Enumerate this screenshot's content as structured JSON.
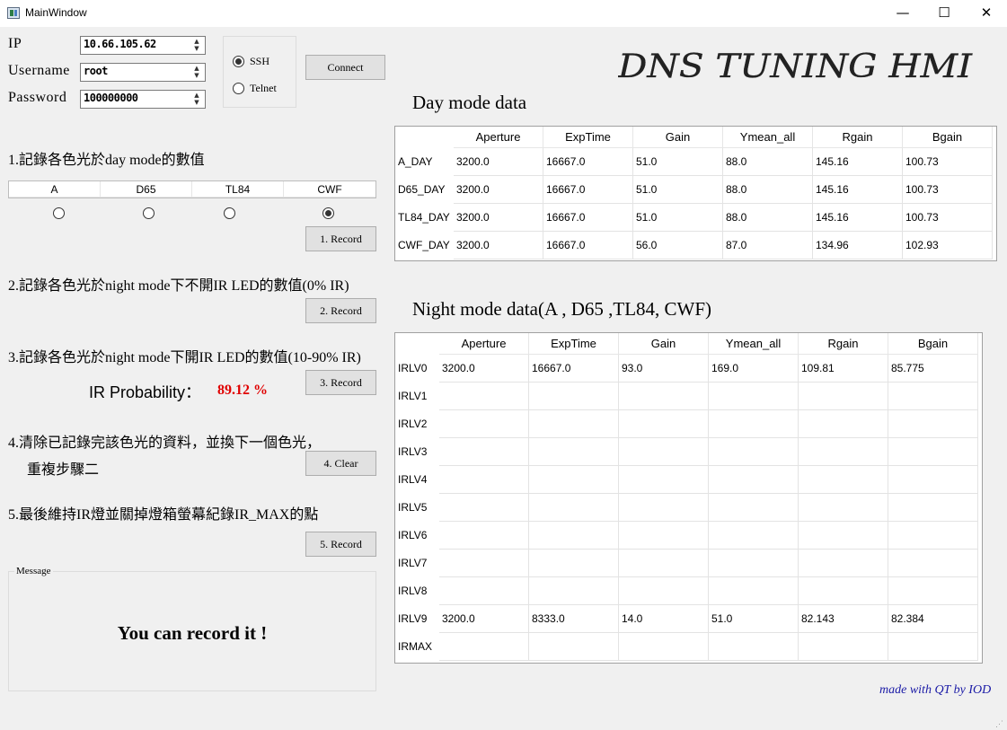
{
  "window": {
    "title": "MainWindow",
    "minimize": "—",
    "maximize": "☐",
    "close": "✕"
  },
  "connection": {
    "ip_label": "IP",
    "ip_value": "10.66.105.62",
    "username_label": "Username",
    "username_value": "root",
    "password_label": "Password",
    "password_value": "100000000",
    "protocol_options": [
      {
        "label": "SSH",
        "selected": true
      },
      {
        "label": "Telnet",
        "selected": false
      }
    ],
    "connect_button": "Connect"
  },
  "brand": {
    "title": "DNS TUNING HMI",
    "credit": "made with QT by IOD"
  },
  "steps": {
    "step1": "1.記錄各色光於day mode的數值",
    "light_sources": [
      {
        "label": "A",
        "selected": false
      },
      {
        "label": "D65",
        "selected": false
      },
      {
        "label": "TL84",
        "selected": false
      },
      {
        "label": "CWF",
        "selected": true
      }
    ],
    "record1_button": "1. Record",
    "step2": "2.記錄各色光於night mode下不開IR LED的數值(0% IR)",
    "record2_button": "2. Record",
    "step3": "3.記錄各色光於night mode下開IR LED的數值(10-90% IR)",
    "record3_button": "3. Record",
    "ir_probability_label": "IR Probability：",
    "ir_probability_value": "89.12 %",
    "step4_line1": "4.清除已記錄完該色光的資料，並換下一個色光，",
    "step4_line2": "重複步驟二",
    "clear_button": "4. Clear",
    "step5": "5.最後維持IR燈並關掉燈箱螢幕紀錄IR_MAX的點",
    "record5_button": "5. Record"
  },
  "message": {
    "group_title": "Message",
    "text": "You can record it !"
  },
  "day_table": {
    "title": "Day mode data",
    "columns": [
      "Aperture",
      "ExpTime",
      "Gain",
      "Ymean_all",
      "Rgain",
      "Bgain"
    ],
    "rows": [
      {
        "label": "A_DAY",
        "cells": [
          "3200.0",
          "16667.0",
          "51.0",
          "88.0",
          "145.16",
          "100.73"
        ]
      },
      {
        "label": "D65_DAY",
        "cells": [
          "3200.0",
          "16667.0",
          "51.0",
          "88.0",
          "145.16",
          "100.73"
        ]
      },
      {
        "label": "TL84_DAY",
        "cells": [
          "3200.0",
          "16667.0",
          "51.0",
          "88.0",
          "145.16",
          "100.73"
        ]
      },
      {
        "label": "CWF_DAY",
        "cells": [
          "3200.0",
          "16667.0",
          "56.0",
          "87.0",
          "134.96",
          "102.93"
        ]
      }
    ]
  },
  "night_table": {
    "title": "Night mode data(A , D65 ,TL84, CWF)",
    "columns": [
      "Aperture",
      "ExpTime",
      "Gain",
      "Ymean_all",
      "Rgain",
      "Bgain"
    ],
    "rows": [
      {
        "label": "IRLV0",
        "cells": [
          "3200.0",
          "16667.0",
          "93.0",
          "169.0",
          "109.81",
          "85.775"
        ]
      },
      {
        "label": "IRLV1",
        "cells": [
          "",
          "",
          "",
          "",
          "",
          ""
        ]
      },
      {
        "label": "IRLV2",
        "cells": [
          "",
          "",
          "",
          "",
          "",
          ""
        ]
      },
      {
        "label": "IRLV3",
        "cells": [
          "",
          "",
          "",
          "",
          "",
          ""
        ]
      },
      {
        "label": "IRLV4",
        "cells": [
          "",
          "",
          "",
          "",
          "",
          ""
        ]
      },
      {
        "label": "IRLV5",
        "cells": [
          "",
          "",
          "",
          "",
          "",
          ""
        ]
      },
      {
        "label": "IRLV6",
        "cells": [
          "",
          "",
          "",
          "",
          "",
          ""
        ]
      },
      {
        "label": "IRLV7",
        "cells": [
          "",
          "",
          "",
          "",
          "",
          ""
        ]
      },
      {
        "label": "IRLV8",
        "cells": [
          "",
          "",
          "",
          "",
          "",
          ""
        ]
      },
      {
        "label": "IRLV9",
        "cells": [
          "3200.0",
          "8333.0",
          "14.0",
          "51.0",
          "82.143",
          "82.384"
        ]
      },
      {
        "label": "IRMAX",
        "cells": [
          "",
          "",
          "",
          "",
          "",
          ""
        ]
      }
    ]
  },
  "colors": {
    "ir_value": "#e00000",
    "credit": "#1a1aa6"
  }
}
